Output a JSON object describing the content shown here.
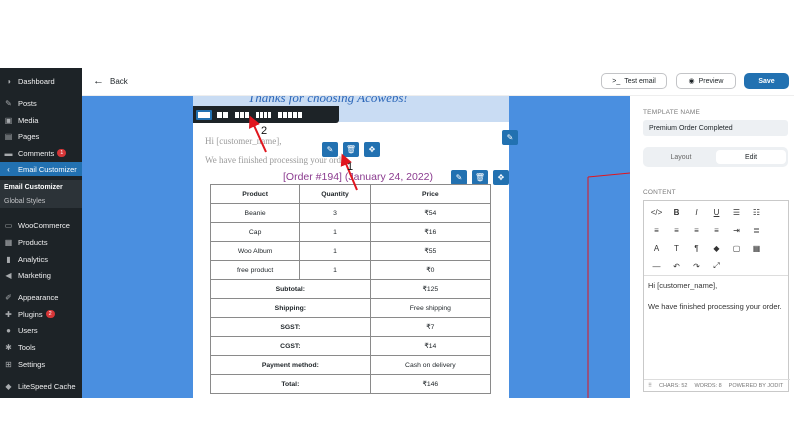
{
  "sidebar": {
    "items": [
      {
        "label": "Dashboard",
        "icon": "dashboard-icon",
        "glyph": "◑"
      },
      {
        "label": "Posts",
        "icon": "pin-icon",
        "glyph": "✎"
      },
      {
        "label": "Media",
        "icon": "media-icon",
        "glyph": "▣"
      },
      {
        "label": "Pages",
        "icon": "pages-icon",
        "glyph": "▤"
      },
      {
        "label": "Comments",
        "icon": "comments-icon",
        "glyph": "▬",
        "badge": "1"
      },
      {
        "label": "Email Customizer",
        "icon": "email-customizer-icon",
        "glyph": "‹"
      },
      {
        "label": "WooCommerce",
        "icon": "woocommerce-icon",
        "glyph": "▭"
      },
      {
        "label": "Products",
        "icon": "products-icon",
        "glyph": "▦"
      },
      {
        "label": "Analytics",
        "icon": "analytics-icon",
        "glyph": "▮"
      },
      {
        "label": "Marketing",
        "icon": "marketing-icon",
        "glyph": "◀"
      },
      {
        "label": "Appearance",
        "icon": "appearance-icon",
        "glyph": "✐"
      },
      {
        "label": "Plugins",
        "icon": "plugins-icon",
        "glyph": "✚",
        "badge": "2"
      },
      {
        "label": "Users",
        "icon": "users-icon",
        "glyph": "●"
      },
      {
        "label": "Tools",
        "icon": "tools-icon",
        "glyph": "✱"
      },
      {
        "label": "Settings",
        "icon": "settings-icon",
        "glyph": "⊞"
      },
      {
        "label": "LiteSpeed Cache",
        "icon": "litespeed-icon",
        "glyph": "◆"
      }
    ],
    "sub_items": [
      "Email Customizer",
      "Global Styles"
    ]
  },
  "header": {
    "back_label": "Back",
    "test_email_label": "Test email",
    "preview_label": "Preview",
    "save_label": "Save"
  },
  "email": {
    "header_text": "Thanks for choosing Acowebs!",
    "greeting": "Hi [customer_name],",
    "body_text": "We have finished processing your orde",
    "order_title": "[Order #194] (January 24, 2022)",
    "columns": [
      "Product",
      "Quantity",
      "Price"
    ],
    "rows": [
      [
        "Beanie",
        "3",
        "₹54"
      ],
      [
        "Cap",
        "1",
        "₹16"
      ],
      [
        "Woo Album",
        "1",
        "₹55"
      ],
      [
        "free product",
        "1",
        "₹0"
      ]
    ],
    "totals": [
      [
        "Subtotal:",
        "₹125"
      ],
      [
        "Shipping:",
        "Free shipping"
      ],
      [
        "SGST:",
        "₹7"
      ],
      [
        "CGST:",
        "₹14"
      ],
      [
        "Payment method:",
        "Cash on delivery"
      ],
      [
        "Total:",
        "₹146"
      ]
    ]
  },
  "annotations": {
    "label_1": "1",
    "label_2": "2",
    "color": "#e0161e"
  },
  "panel": {
    "template_name_label": "TEMPLATE NAME",
    "template_name_value": "Premium Order Completed",
    "layout_tab": "Layout",
    "edit_tab": "Edit",
    "content_label": "CONTENT",
    "editor_line1": "Hi [customer_name],",
    "editor_line2": "We have finished processing your order.",
    "footer_chars": "CHARS: 52",
    "footer_words": "WORDS: 8",
    "footer_powered": "POWERED BY JODIT"
  },
  "colors": {
    "accent": "#2271b1",
    "canvas": "#4a8fe0",
    "admin_bar": "#1d2327",
    "order_title": "#8b3b8f"
  }
}
